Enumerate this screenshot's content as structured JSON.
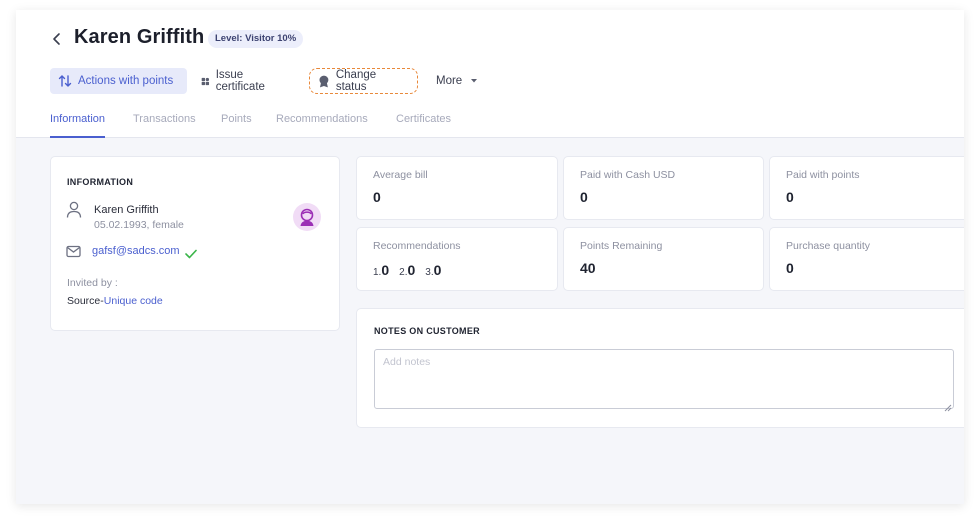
{
  "header": {
    "title": "Karen Griffith",
    "level_badge": "Level: Visitor 10%"
  },
  "toolbar": {
    "actions_label": "Actions with points",
    "certificate_label": "Issue certificate",
    "status_label": "Change status",
    "more_label": "More"
  },
  "tabs": [
    {
      "label": "Information",
      "active": true
    },
    {
      "label": "Transactions",
      "active": false
    },
    {
      "label": "Points",
      "active": false
    },
    {
      "label": "Recommendations",
      "active": false
    },
    {
      "label": "Certificates",
      "active": false
    }
  ],
  "info": {
    "heading": "INFORMATION",
    "name": "Karen Griffith",
    "details": "05.02.1993, female",
    "email": "gafsf@sadcs.com",
    "invited_label": "Invited by :",
    "source_label": "Source-",
    "source_value": "Unique code"
  },
  "stats": {
    "average_bill": {
      "label": "Average bill",
      "value": "0"
    },
    "paid_cash": {
      "label": "Paid with Cash USD",
      "value": "0"
    },
    "paid_points": {
      "label": "Paid with points",
      "value": "0"
    },
    "recommendations": {
      "label": "Recommendations",
      "items": [
        {
          "index": "1.",
          "value": "0"
        },
        {
          "index": "2.",
          "value": "0"
        },
        {
          "index": "3.",
          "value": "0"
        }
      ]
    },
    "points_remaining": {
      "label": "Points Remaining",
      "value": "40"
    },
    "purchase_quantity": {
      "label": "Purchase quantity",
      "value": "0"
    }
  },
  "notes": {
    "heading": "NOTES ON CUSTOMER",
    "placeholder": "Add notes"
  },
  "colors": {
    "accent": "#4a5fcf",
    "highlight_border": "#e8883a",
    "success": "#3bb54a",
    "avatar": "#9b2fb5"
  },
  "icons": {
    "back": "chevron-left-icon",
    "actions": "arrows-up-down-icon",
    "certificate": "certificate-icon",
    "status": "status-badge-icon",
    "more": "caret-down-icon",
    "user": "user-icon",
    "avatar": "avatar-icon",
    "mail": "mail-icon",
    "check": "check-icon"
  }
}
